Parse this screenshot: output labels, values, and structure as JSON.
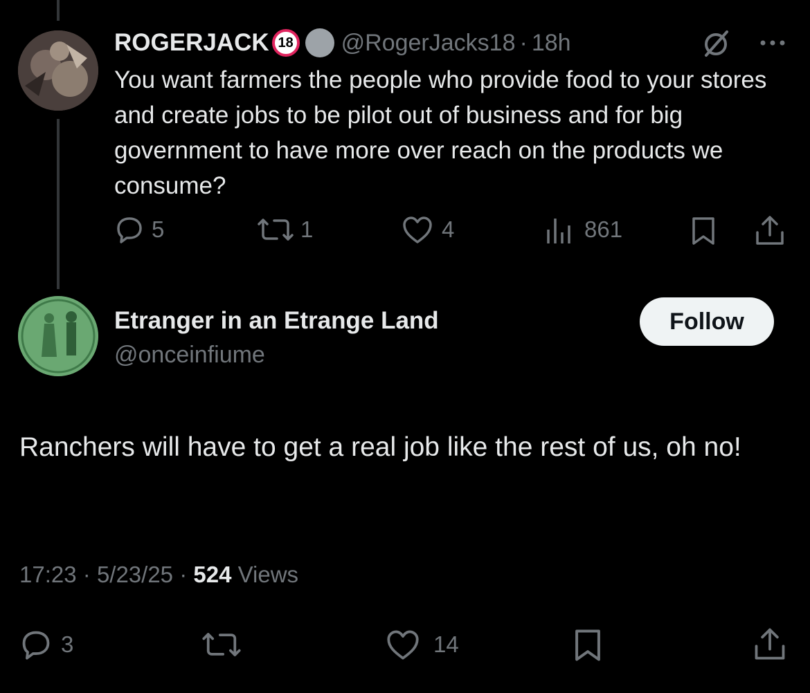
{
  "parent_tweet": {
    "display_name": "ROGERJACK",
    "badge_text": "18",
    "handle": "@RogerJacks18",
    "separator": "·",
    "time": "18h",
    "text": "You want farmers the people who provide food to your stores and create jobs to be pilot out of business and for big government to have more over reach on the products we consume?",
    "replies": "5",
    "reposts": "1",
    "likes": "4",
    "views": "861"
  },
  "main_tweet": {
    "display_name": "Etranger in an Etrange Land",
    "handle": "@onceinfiume",
    "follow_label": "Follow",
    "text": "Ranchers will have to get a real job like the rest of us, oh no!",
    "time": "17:23",
    "date": "5/23/25",
    "sep1": "·",
    "sep2": "·",
    "view_count": "524",
    "views_label": "Views",
    "replies": "3",
    "likes": "14"
  },
  "colors": {
    "background": "#000000",
    "text": "#e7e9ea",
    "muted": "#71767b",
    "follow_bg": "#eff3f4"
  },
  "icons": [
    "reply-icon",
    "repost-icon",
    "like-icon",
    "views-icon",
    "bookmark-icon",
    "share-icon",
    "grok-icon",
    "more-icon"
  ]
}
